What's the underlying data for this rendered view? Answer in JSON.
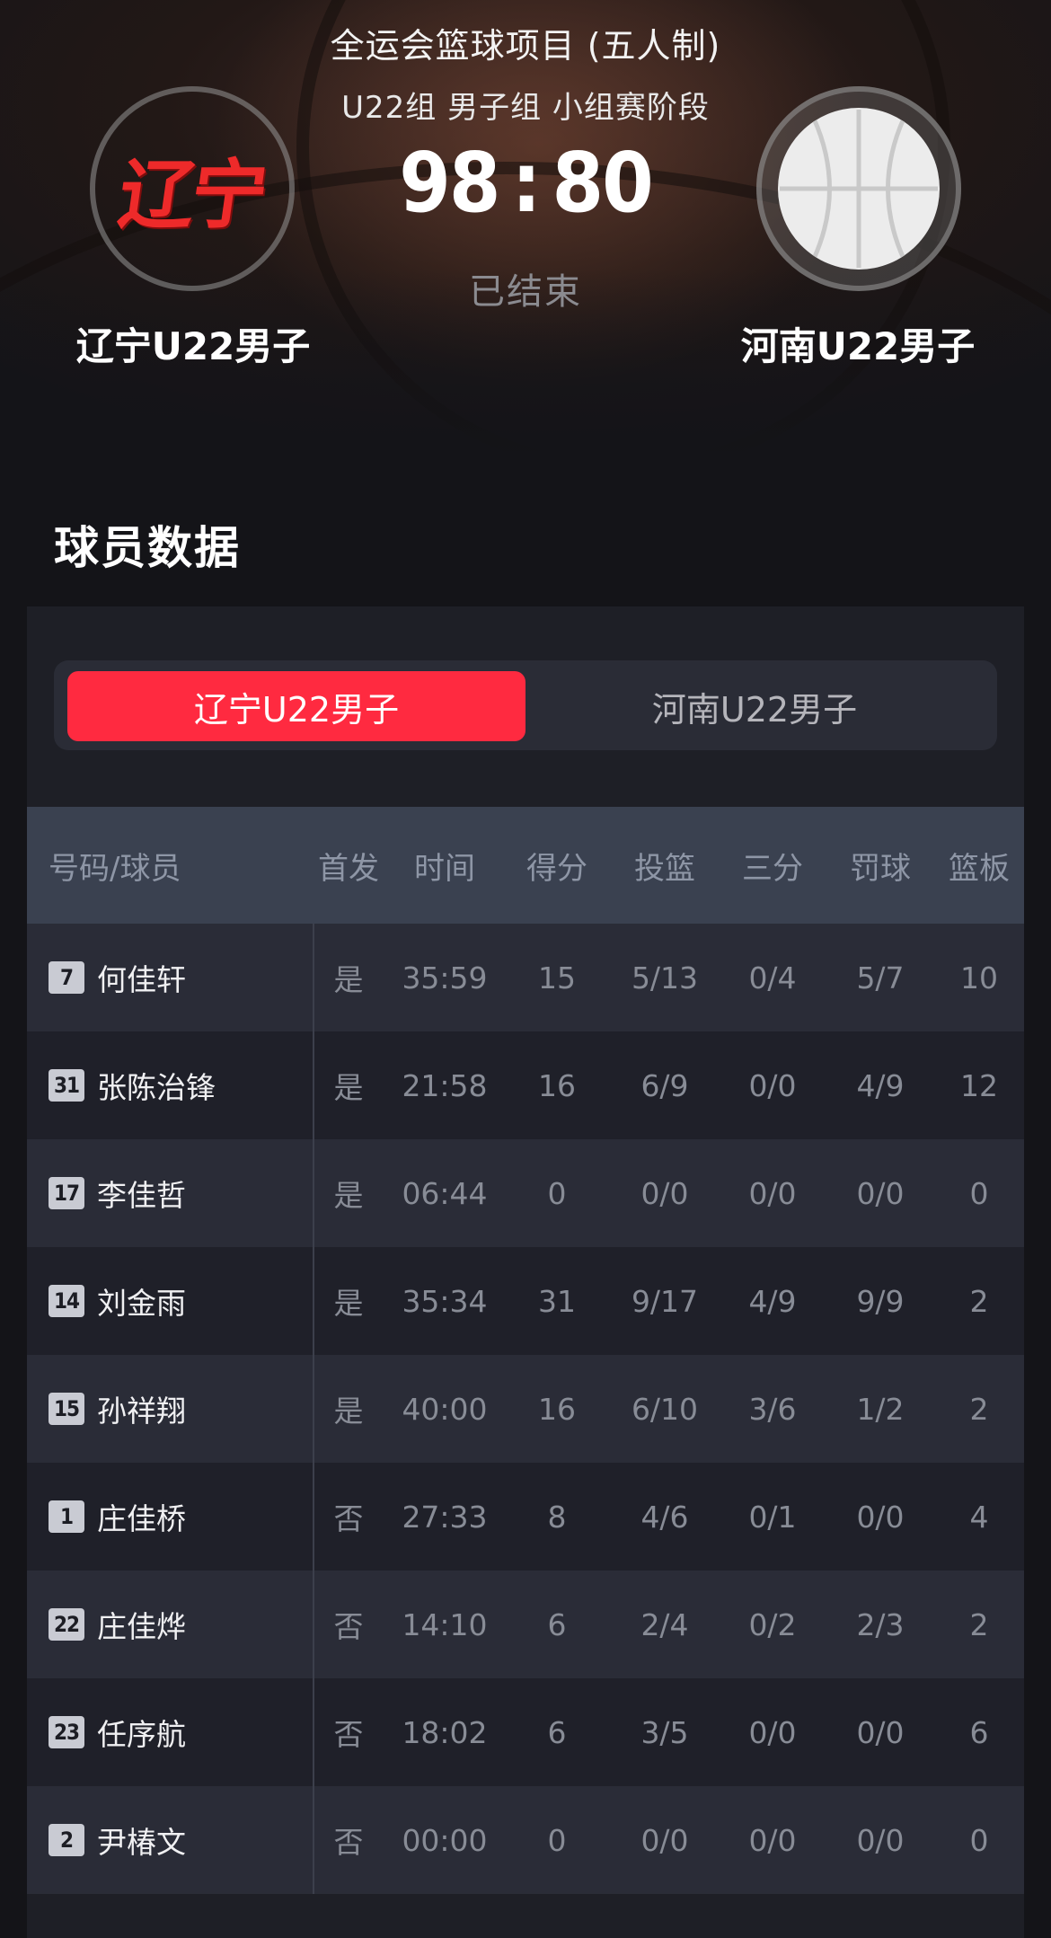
{
  "header": {
    "event_title": "全运会篮球项目 (五人制)",
    "event_subtitle": "U22组 男子组 小组赛阶段",
    "home_score": "98",
    "score_separator": ":",
    "away_score": "80",
    "status": "已结束",
    "home_team": "辽宁U22男子",
    "away_team": "河南U22男子",
    "home_logo_text": "辽宁",
    "away_logo_icon": "basketball-icon"
  },
  "section": {
    "title": "球员数据"
  },
  "team_tabs": [
    {
      "label": "辽宁U22男子",
      "active": true
    },
    {
      "label": "河南U22男子",
      "active": false
    }
  ],
  "colors": {
    "accent": "#ff2a40",
    "background": "#141418",
    "table_header": "#3a4150"
  },
  "table": {
    "headers": [
      "号码/球员",
      "首发",
      "时间",
      "得分",
      "投篮",
      "三分",
      "罚球",
      "篮板"
    ],
    "rows": [
      {
        "number": "7",
        "name": "何佳轩",
        "starter": "是",
        "time": "35:59",
        "points": "15",
        "fg": "5/13",
        "three": "0/4",
        "ft": "5/7",
        "reb": "10"
      },
      {
        "number": "31",
        "name": "张陈治锋",
        "starter": "是",
        "time": "21:58",
        "points": "16",
        "fg": "6/9",
        "three": "0/0",
        "ft": "4/9",
        "reb": "12"
      },
      {
        "number": "17",
        "name": "李佳哲",
        "starter": "是",
        "time": "06:44",
        "points": "0",
        "fg": "0/0",
        "three": "0/0",
        "ft": "0/0",
        "reb": "0"
      },
      {
        "number": "14",
        "name": "刘金雨",
        "starter": "是",
        "time": "35:34",
        "points": "31",
        "fg": "9/17",
        "three": "4/9",
        "ft": "9/9",
        "reb": "2"
      },
      {
        "number": "15",
        "name": "孙祥翔",
        "starter": "是",
        "time": "40:00",
        "points": "16",
        "fg": "6/10",
        "three": "3/6",
        "ft": "1/2",
        "reb": "2"
      },
      {
        "number": "1",
        "name": "庄佳桥",
        "starter": "否",
        "time": "27:33",
        "points": "8",
        "fg": "4/6",
        "three": "0/1",
        "ft": "0/0",
        "reb": "4"
      },
      {
        "number": "22",
        "name": "庄佳烨",
        "starter": "否",
        "time": "14:10",
        "points": "6",
        "fg": "2/4",
        "three": "0/2",
        "ft": "2/3",
        "reb": "2"
      },
      {
        "number": "23",
        "name": "任序航",
        "starter": "否",
        "time": "18:02",
        "points": "6",
        "fg": "3/5",
        "three": "0/0",
        "ft": "0/0",
        "reb": "6"
      },
      {
        "number": "2",
        "name": "尹椿文",
        "starter": "否",
        "time": "00:00",
        "points": "0",
        "fg": "0/0",
        "three": "0/0",
        "ft": "0/0",
        "reb": "0"
      }
    ]
  }
}
